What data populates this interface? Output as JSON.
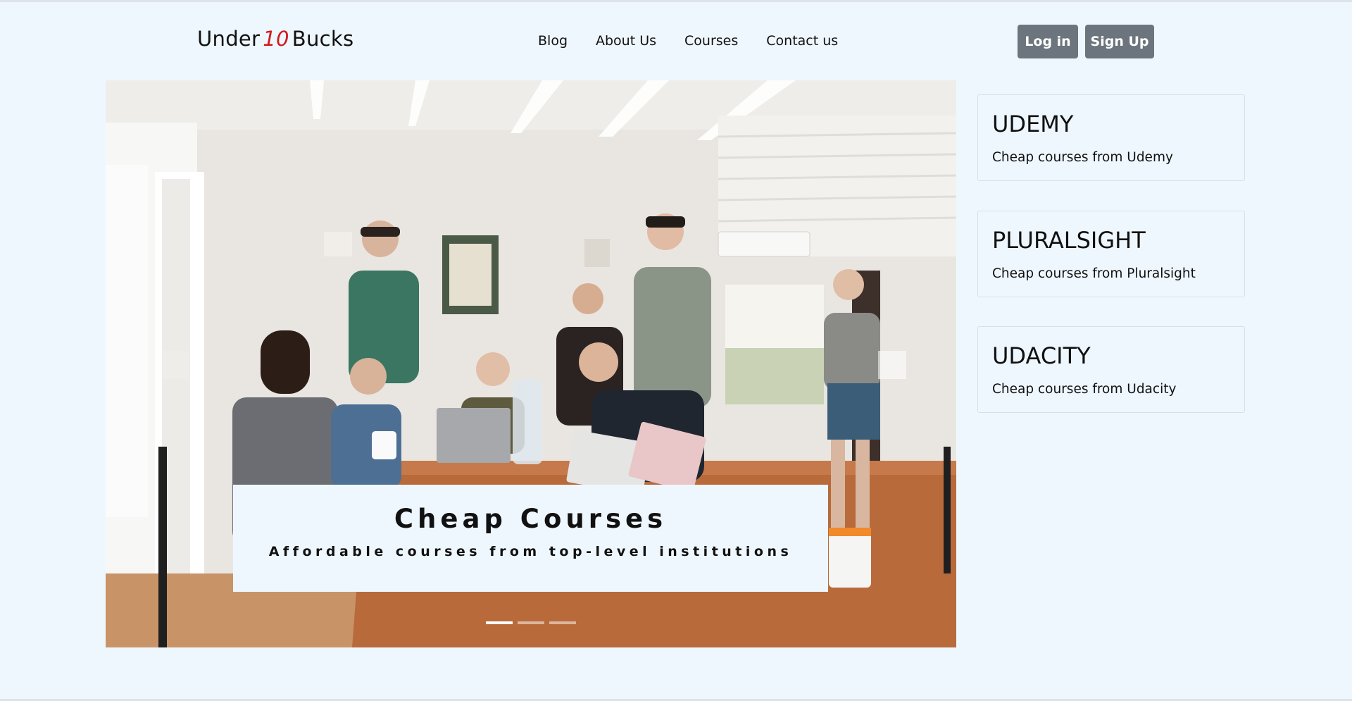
{
  "brand": {
    "prefix": "Under",
    "number": "10",
    "suffix": "Bucks"
  },
  "nav": {
    "items": [
      "Blog",
      "About Us",
      "Courses",
      "Contact us"
    ]
  },
  "auth": {
    "login_label": "Log in",
    "signup_label": "Sign Up"
  },
  "hero": {
    "caption_title": "Cheap Courses",
    "caption_subtitle": "Affordable courses from top-level institutions",
    "slide_count": 3,
    "active_slide": 1
  },
  "cards": [
    {
      "title": "UDEMY",
      "text": "Cheap courses from Udemy"
    },
    {
      "title": "PLURALSIGHT",
      "text": "Cheap courses from Pluralsight"
    },
    {
      "title": "UDACITY",
      "text": "Cheap courses from Udacity"
    }
  ],
  "colors": {
    "background": "#eff7fe",
    "brand_accent": "#d21a1a",
    "button": "#6c757d"
  }
}
